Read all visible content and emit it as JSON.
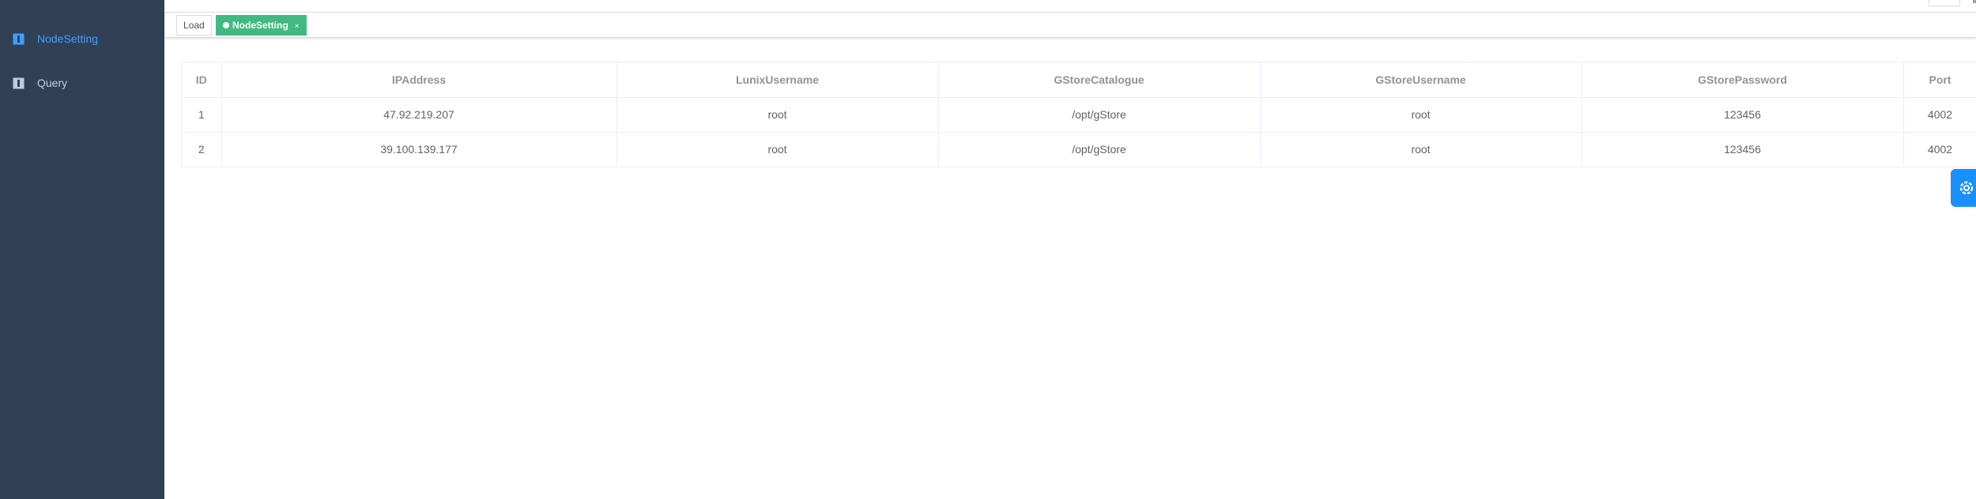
{
  "sidebar": {
    "items": [
      {
        "label": "NodeSetting",
        "icon": "table-icon",
        "active": true
      },
      {
        "label": "Query",
        "icon": "table-icon",
        "active": false
      }
    ]
  },
  "tags": [
    {
      "label": "Load",
      "active": false
    },
    {
      "label": "NodeSetting",
      "active": true,
      "close": "×"
    }
  ],
  "table": {
    "headers": [
      "ID",
      "IPAddress",
      "LunixUsername",
      "GStoreCatalogue",
      "GStoreUsername",
      "GStorePassword",
      "Port"
    ],
    "rows": [
      [
        "1",
        "47.92.219.207",
        "root",
        "/opt/gStore",
        "root",
        "123456",
        "4002"
      ],
      [
        "2",
        "39.100.139.177",
        "root",
        "/opt/gStore",
        "root",
        "123456",
        "4002"
      ]
    ]
  },
  "colors": {
    "sidebar_bg": "#304156",
    "active_menu": "#409eff",
    "active_tag": "#42b983",
    "settings_button": "#1890ff"
  }
}
